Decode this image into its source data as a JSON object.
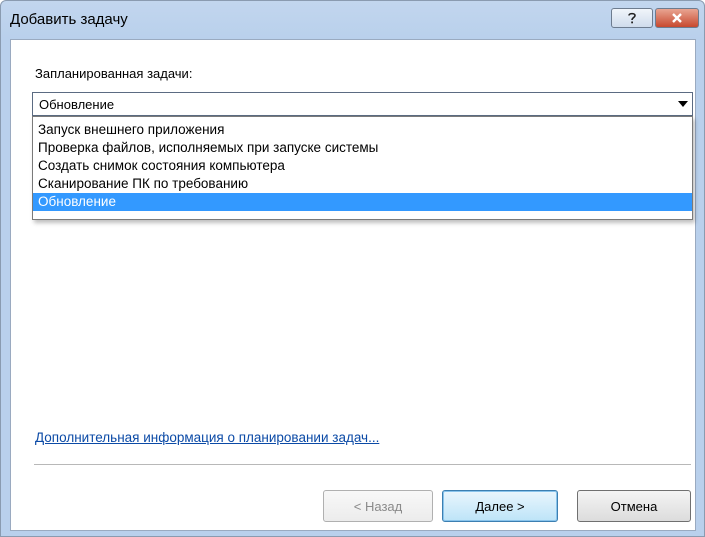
{
  "window": {
    "title": "Добавить задачу",
    "help_icon": "question-icon",
    "close_icon": "close-icon"
  },
  "task": {
    "label": "Запланированная задачи:",
    "selected_value": "Обновление",
    "options": [
      "Запуск внешнего приложения",
      "Проверка файлов, исполняемых при запуске системы",
      "Создать снимок состояния компьютера",
      "Сканирование ПК по требованию",
      "Обновление"
    ],
    "highlighted_index": 4
  },
  "info_link": "Дополнительная информация о планировании задач...",
  "buttons": {
    "back": "< Назад",
    "next": "Далее >",
    "cancel": "Отмена"
  },
  "colors": {
    "selection": "#3399ff",
    "link": "#0b4aa6"
  }
}
